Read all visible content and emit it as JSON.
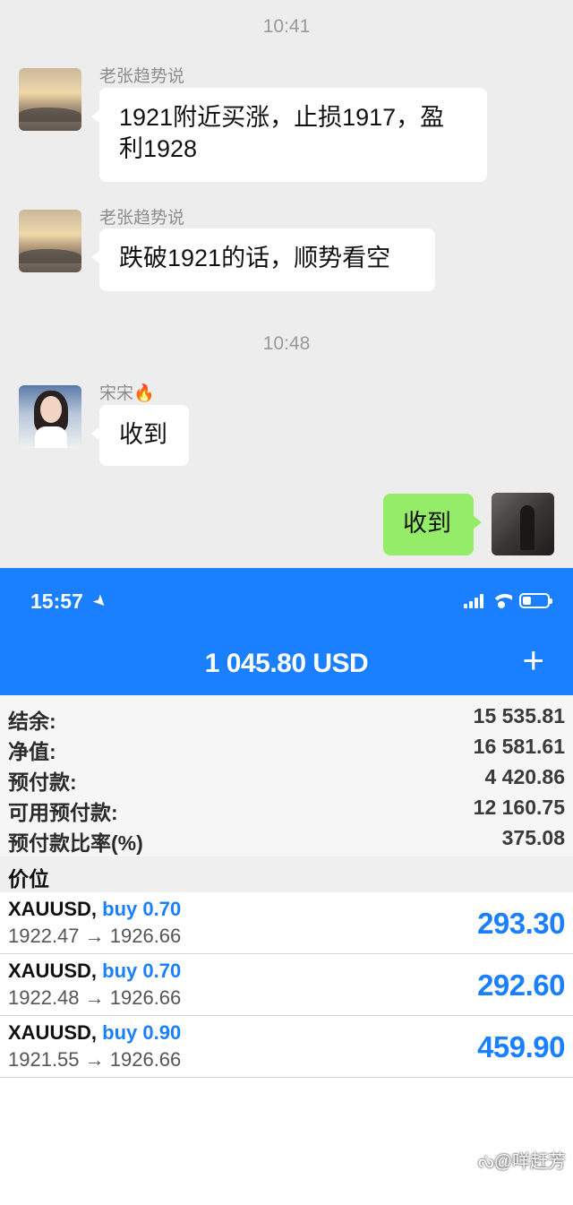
{
  "chat": {
    "time_separators": [
      "10:41",
      "10:48"
    ],
    "messages": [
      {
        "sender": "老张趋势说",
        "lines": [
          "1921附近买涨，止损1917，盈",
          "利1928"
        ],
        "avatar": "sunset-avatar"
      },
      {
        "sender": "老张趋势说",
        "lines": [
          "跌破1921的话，顺势看空"
        ],
        "avatar": "sunset-avatar"
      },
      {
        "sender": "宋宋🔥",
        "lines": [
          "收到"
        ],
        "avatar": "girl-avatar"
      },
      {
        "sender": "",
        "lines": [
          "收到"
        ],
        "avatar": "self-avatar",
        "outgoing": true
      }
    ]
  },
  "trading": {
    "status_bar": {
      "time": "15:57",
      "signal_bars": 4,
      "battery_level": 0.35
    },
    "header": {
      "balance": "1 045.80 USD",
      "add_label": "+"
    },
    "summary": [
      {
        "label": "结余:",
        "value": "15 535.81"
      },
      {
        "label": "净值:",
        "value": "16 581.61"
      },
      {
        "label": "预付款:",
        "value": "4 420.86"
      },
      {
        "label": "可用预付款:",
        "value": "12 160.75"
      },
      {
        "label": "预付款比率(%)",
        "value": "375.08"
      }
    ],
    "section_title": "价位",
    "positions": [
      {
        "symbol": "XAUUSD,",
        "side": "buy 0.70",
        "prices": "1922.47 → 1926.66",
        "profit": "293.30"
      },
      {
        "symbol": "XAUUSD,",
        "side": "buy 0.70",
        "prices": "1922.48 → 1926.66",
        "profit": "292.60"
      },
      {
        "symbol": "XAUUSD,",
        "side": "buy 0.90",
        "prices": "1921.55 → 1926.66",
        "profit": "459.90"
      }
    ]
  },
  "watermark": "ᔔ@咩赶芳",
  "colors": {
    "accent": "#1a80ff",
    "chat_bg": "#ededed",
    "outgoing_bubble": "#95ec69"
  }
}
